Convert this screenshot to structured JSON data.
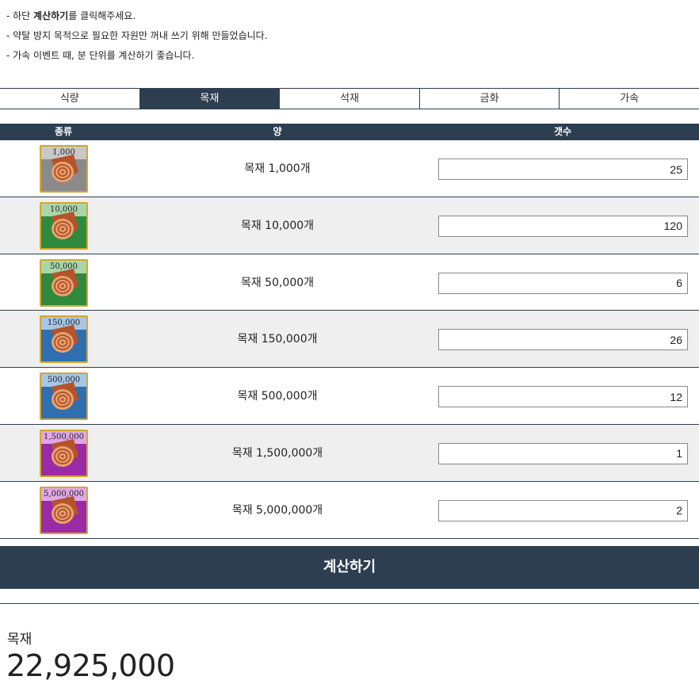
{
  "notes": {
    "line1_prefix": "- 하단 ",
    "line1_bold": "계산하기",
    "line1_suffix": "를 클릭해주세요.",
    "line2": "- 약탈 방지 목적으로 필요한 자원만 꺼내 쓰기 위해 만들었습니다.",
    "line3": "- 가속 이벤트 때, 분 단위를 계산하기 좋습니다."
  },
  "tabs": [
    {
      "label": "식량",
      "active": false
    },
    {
      "label": "목재",
      "active": true
    },
    {
      "label": "석재",
      "active": false
    },
    {
      "label": "금화",
      "active": false
    },
    {
      "label": "가속",
      "active": false
    }
  ],
  "table": {
    "headers": {
      "kind": "종류",
      "amount": "양",
      "count": "갯수"
    },
    "rows": [
      {
        "badge": "1,000",
        "amount_label": "목재 1,000개",
        "count": "25",
        "tier_color": "#8a8a8a",
        "badge_color": "#c8c8c8"
      },
      {
        "badge": "10,000",
        "amount_label": "목재 10,000개",
        "count": "120",
        "tier_color": "#2f8a3e",
        "badge_color": "#a9d6a9"
      },
      {
        "badge": "50,000",
        "amount_label": "목재 50,000개",
        "count": "6",
        "tier_color": "#2f8a3e",
        "badge_color": "#a9d6a9"
      },
      {
        "badge": "150,000",
        "amount_label": "목재 150,000개",
        "count": "26",
        "tier_color": "#2f6fb0",
        "badge_color": "#a6c6e6"
      },
      {
        "badge": "500,000",
        "amount_label": "목재 500,000개",
        "count": "12",
        "tier_color": "#2f6fb0",
        "badge_color": "#a6c6e6"
      },
      {
        "badge": "1,500,000",
        "amount_label": "목재 1,500,000개",
        "count": "1",
        "tier_color": "#9b2aa6",
        "badge_color": "#e0a8e6"
      },
      {
        "badge": "5,000,000",
        "amount_label": "목재 5,000,000개",
        "count": "2",
        "tier_color": "#9b2aa6",
        "badge_color": "#e0a8e6"
      }
    ]
  },
  "calc_button": {
    "label": "계산하기"
  },
  "result": {
    "label": "목재",
    "value": "22,925,000"
  },
  "colors": {
    "primary": "#2c3e50",
    "alt_row": "#efefef",
    "icon_border": "#d4a72c"
  }
}
